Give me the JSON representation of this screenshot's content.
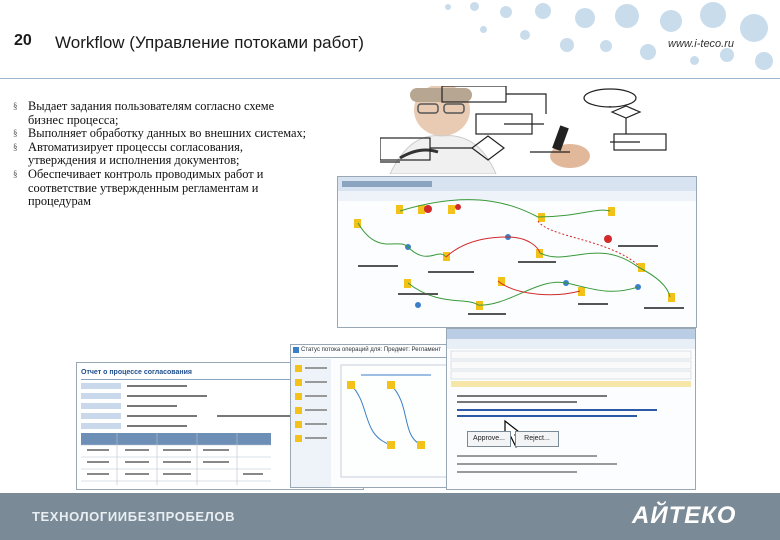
{
  "header": {
    "slide_number": "20",
    "title": "Workflow (Управление потоками работ)",
    "website": "www.i-teco.ru"
  },
  "bullets": [
    "Выдает задания пользователям согласно схеме бизнес процесса;",
    "Выполняет обработку данных во внешних системах;",
    "Автоматизирует процессы согласования, утверждения и исполнения документов;",
    "Обеспечивает контроль проводимых работ и соответствие утвержденным регламентам и процедурам"
  ],
  "report_screenshot": {
    "title": "Отчет о процессе согласования"
  },
  "status_screenshot": {
    "title": "Статус потока операций для: Предмет: Регламент"
  },
  "outlook_screenshot": {
    "approve_button": "Approve...",
    "reject_button": "Reject..."
  },
  "footer": {
    "tagline": "ТЕХНОЛОГИИБЕЗПРОБЕЛОВ",
    "logo": "АЙТЕКО"
  },
  "colors": {
    "footer": "#7a8a97",
    "header_dots": "#c9dcec",
    "workflow_line_red": "#d22a2a",
    "workflow_line_green": "#3a9a3a",
    "node_yellow": "#f2c21b",
    "node_blue": "#3c7fc8"
  }
}
